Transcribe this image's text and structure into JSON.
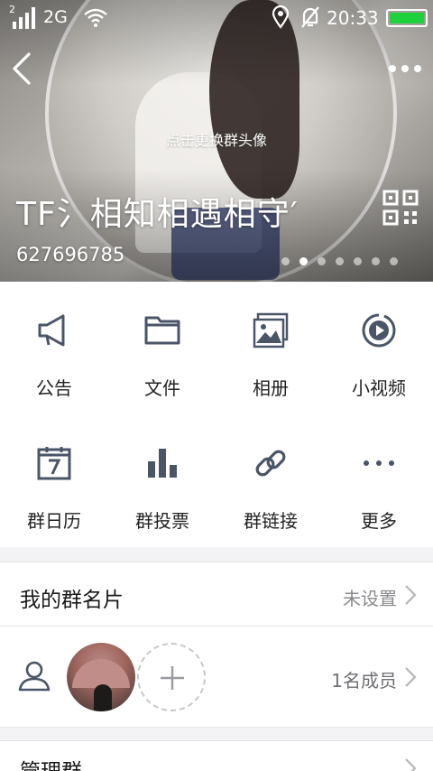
{
  "status_bar": {
    "sim_slot": "2",
    "network": "2G",
    "time": "20:33",
    "battery_color": "#1fd13a"
  },
  "header": {
    "change_avatar_hint": "点击更换群头像",
    "group_name": "TF氵相知相遇相守′",
    "group_id": "627696785",
    "page_dots": 7,
    "active_dot": 1
  },
  "actions": [
    {
      "label": "公告",
      "icon": "megaphone-icon"
    },
    {
      "label": "文件",
      "icon": "folder-icon"
    },
    {
      "label": "相册",
      "icon": "album-icon"
    },
    {
      "label": "小视频",
      "icon": "video-icon"
    },
    {
      "label": "群日历",
      "icon": "calendar-icon"
    },
    {
      "label": "群投票",
      "icon": "vote-chart-icon"
    },
    {
      "label": "群链接",
      "icon": "link-icon"
    },
    {
      "label": "更多",
      "icon": "more-dots-icon"
    }
  ],
  "group_card": {
    "title": "我的群名片",
    "value": "未设置"
  },
  "members": {
    "count_text": "1名成员"
  },
  "manage": {
    "title": "管理群"
  },
  "colors": {
    "icon_gray": "#4a5568",
    "text_secondary": "#8a8a8e"
  }
}
